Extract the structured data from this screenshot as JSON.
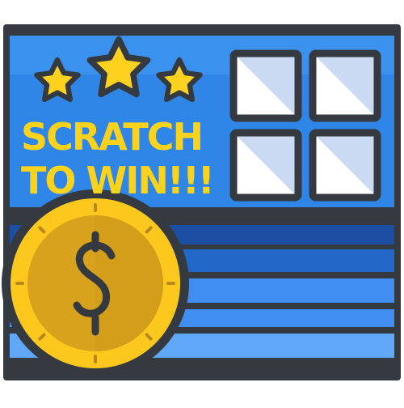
{
  "card": {
    "headline": {
      "line1": "SCRATCH",
      "line2": "TO WIN!!!"
    },
    "stars": {
      "count": 3,
      "icon": "star-icon"
    },
    "scratch_panels": {
      "count": 4,
      "icon": "scratch-panel-icon"
    },
    "coin": {
      "icon": "dollar-coin-icon",
      "symbol": "$"
    }
  },
  "colors": {
    "outline": "#353a40",
    "card_blue": "#2f86e6",
    "band_dark": "#1c4fa3",
    "band_mid": "#2168c9",
    "band_light": "#3f8ef0",
    "band_pale": "#5fa7f7",
    "star_yellow": "#ffd21f",
    "text_yellow": "#fcd31c",
    "panel_fill": "#ffffff",
    "panel_shade": "#c9daf2",
    "coin_outer": "#fcc81e",
    "coin_inner": "#d8a21c",
    "coin_tick": "#b9881a"
  }
}
